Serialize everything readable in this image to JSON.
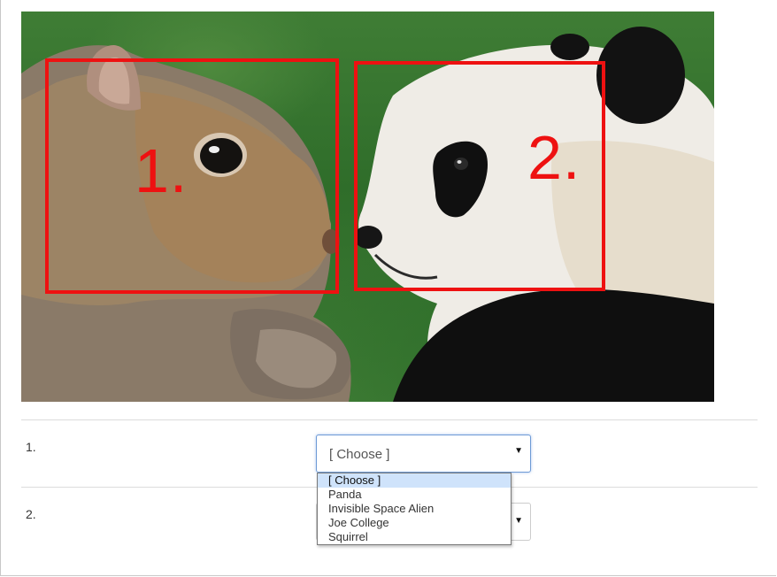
{
  "image": {
    "box_labels": [
      "1.",
      "2."
    ],
    "box_color": "#ee1111"
  },
  "questions": [
    {
      "label": "1.",
      "select": {
        "value": "[ Choose ]",
        "expanded": true
      }
    },
    {
      "label": "2.",
      "select": {
        "value": "",
        "expanded": false
      }
    }
  ],
  "dropdown": {
    "options": [
      "[ Choose ]",
      "Panda",
      "Invisible Space Alien",
      "Joe College",
      "Squirrel"
    ],
    "highlighted": "[ Choose ]"
  },
  "colors": {
    "focus_border": "#6e9ad6",
    "highlight": "#cfe3fb"
  }
}
